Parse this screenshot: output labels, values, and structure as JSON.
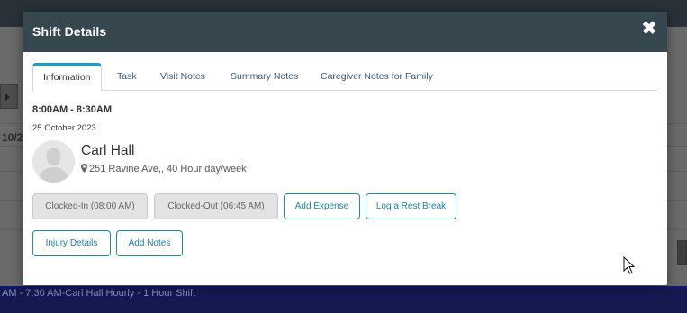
{
  "background": {
    "left_partial_text": "10/2",
    "bottom_bar_text": "AM - 7:30 AM-Carl Hall Hourly - 1 Hour Shift"
  },
  "modal": {
    "title": "Shift Details",
    "close_label": "✖",
    "tabs": [
      {
        "label": "Information",
        "active": true
      },
      {
        "label": "Task",
        "active": false
      },
      {
        "label": "Visit Notes",
        "active": false
      },
      {
        "label": "Summary Notes",
        "active": false
      },
      {
        "label": "Caregiver Notes for Family",
        "active": false
      }
    ],
    "shift": {
      "time_range": "8:00AM - 8:30AM",
      "date": "25 October 2023"
    },
    "caregiver": {
      "name": "Carl Hall",
      "address": "251 Ravine Ave,, 40 Hour day/week"
    },
    "buttons": {
      "clocked_in": "Clocked-In (08:00 AM)",
      "clocked_out": "Clocked-Out (06:45 AM)",
      "add_expense": "Add Expense",
      "log_rest_break": "Log a Rest Break",
      "injury_details": "Injury Details",
      "add_notes": "Add Notes"
    }
  },
  "colors": {
    "header_bg": "#37474f",
    "accent": "#1a9cc7",
    "button_border": "#1c8aa8",
    "bottom_bar": "#141a4f"
  }
}
